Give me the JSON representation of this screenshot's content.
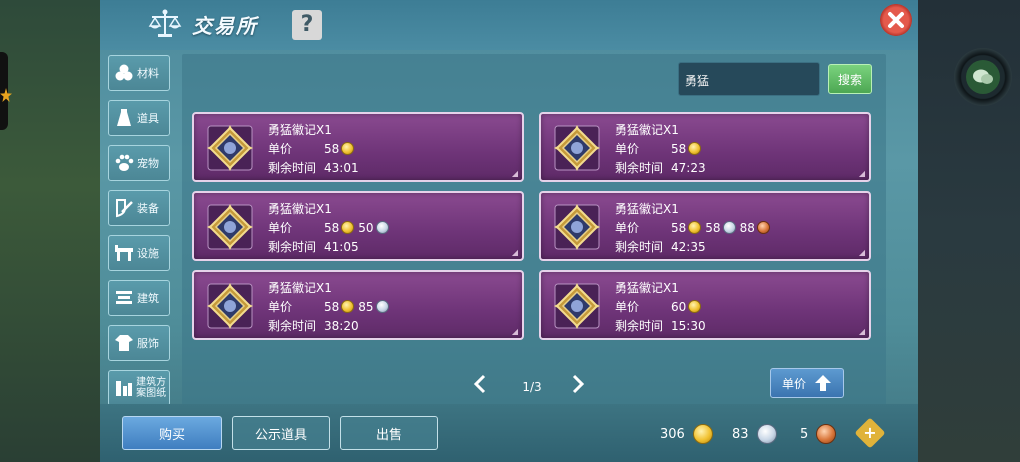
{
  "window": {
    "title": "交易所",
    "help_label": "?"
  },
  "sidebar": {
    "items": [
      {
        "label": "材料",
        "icon": "material-icon"
      },
      {
        "label": "道具",
        "icon": "item-icon"
      },
      {
        "label": "宠物",
        "icon": "pet-icon"
      },
      {
        "label": "装备",
        "icon": "equipment-icon"
      },
      {
        "label": "设施",
        "icon": "facility-icon"
      },
      {
        "label": "建筑",
        "icon": "building-icon"
      },
      {
        "label": "服饰",
        "icon": "clothing-icon"
      },
      {
        "label": "建筑方案图纸",
        "icon": "blueprint-icon"
      }
    ]
  },
  "search": {
    "value": "勇猛",
    "button_label": "搜索"
  },
  "listings": [
    {
      "name": "勇猛徽记X1",
      "price_label": "单价",
      "price_gold": "58",
      "time_label": "剩余时间",
      "time": "43:01"
    },
    {
      "name": "勇猛徽记X1",
      "price_label": "单价",
      "price_gold": "58",
      "time_label": "剩余时间",
      "time": "47:23"
    },
    {
      "name": "勇猛徽记X1",
      "price_label": "单价",
      "price_gold": "58",
      "price_silver": "50",
      "time_label": "剩余时间",
      "time": "41:05"
    },
    {
      "name": "勇猛徽记X1",
      "price_label": "单价",
      "price_gold": "58",
      "price_silver": "58",
      "price_copper": "88",
      "time_label": "剩余时间",
      "time": "42:35"
    },
    {
      "name": "勇猛徽记X1",
      "price_label": "单价",
      "price_gold": "58",
      "price_silver": "85",
      "time_label": "剩余时间",
      "time": "38:20"
    },
    {
      "name": "勇猛徽记X1",
      "price_label": "单价",
      "price_gold": "60",
      "time_label": "剩余时间",
      "time": "15:30"
    }
  ],
  "pagination": {
    "page": "1/3"
  },
  "sort": {
    "label": "单价"
  },
  "footer": {
    "buy_label": "购买",
    "public_items_label": "公示道具",
    "sell_label": "出售",
    "gold": "306",
    "silver": "83",
    "copper": "5"
  },
  "colors": {
    "card_purple": "#6e3478",
    "buy_blue": "#3f7ec0",
    "search_green": "#4da753",
    "close_red": "#e45a4c"
  }
}
